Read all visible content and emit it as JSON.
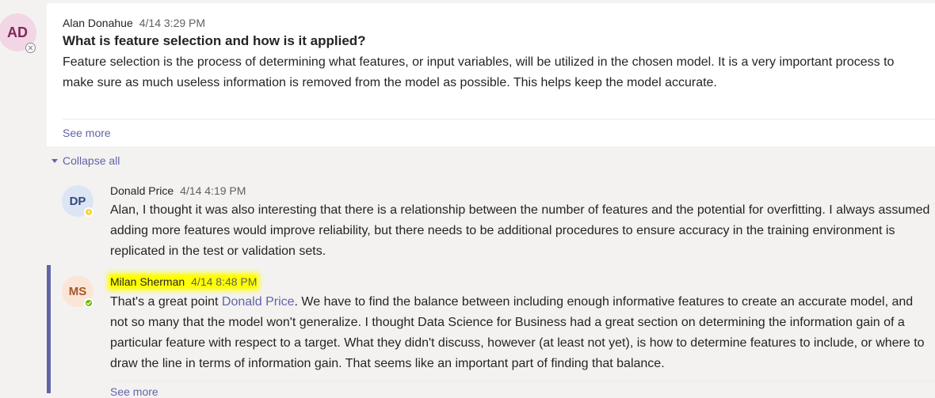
{
  "post": {
    "avatar_initials": "AD",
    "author": "Alan Donahue",
    "timestamp": "4/14 3:29 PM",
    "subject": "What is feature selection and how is it applied?",
    "body": "Feature selection is the process of determining what features, or input variables, will be utilized in the chosen model. It is a very important process to make sure as much useless information is removed from the model as possible. This helps keep the model accurate.",
    "see_more": "See more"
  },
  "thread": {
    "collapse_label": "Collapse all"
  },
  "replies": [
    {
      "avatar_initials": "DP",
      "author": "Donald Price",
      "timestamp": "4/14 4:19 PM",
      "body": "Alan, I thought it was also interesting that there is a relationship between the number of features and the potential for overfitting. I always assumed adding more features would improve reliability, but there needs to be additional procedures to ensure accuracy in the training environment is replicated in the test or validation sets."
    },
    {
      "avatar_initials": "MS",
      "author": "Milan Sherman",
      "timestamp": "4/14 8:48 PM",
      "body_prefix": "That's a great point ",
      "mention": "Donald Price",
      "body_suffix": ".  We have to find the balance between including enough informative features to create an accurate model, and not so many that the model won't generalize.  I thought Data Science for Business had a great section on determining the information gain of a particular feature with respect to a target.  What they didn't discuss, however (at least not yet), is how to determine features to include, or where to draw the line in terms of information gain.  That seems like an important part of finding that balance.",
      "see_more": "See more"
    }
  ],
  "colors": {
    "accent": "#6264a7",
    "highlight": "#ffff00",
    "presence_away": "#f8d22a",
    "presence_available": "#6bb700"
  }
}
